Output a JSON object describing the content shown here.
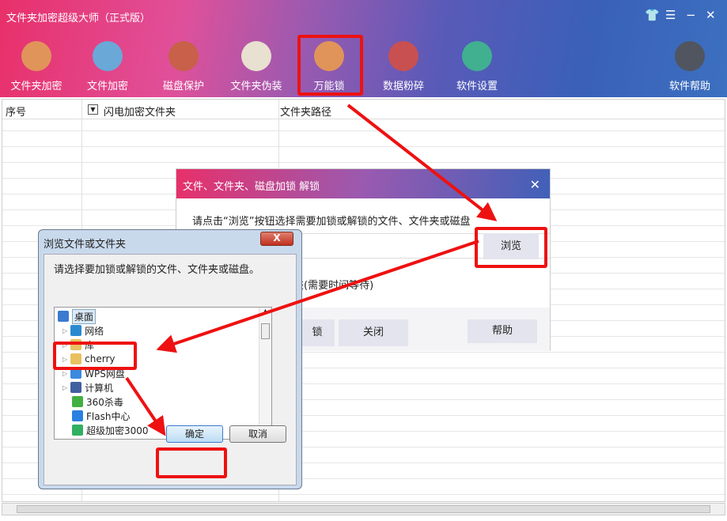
{
  "app": {
    "title": "文件夹加密超级大师（正式版）",
    "controls": [
      "skin",
      "menu",
      "minimize",
      "close"
    ]
  },
  "toolbar": [
    {
      "label": "文件夹加密",
      "icon": "folder-icon",
      "color": "#e0945a"
    },
    {
      "label": "文件加密",
      "icon": "clipboard-icon",
      "color": "#6aa8d8"
    },
    {
      "label": "磁盘保护",
      "icon": "shield-icon",
      "color": "#c8604a"
    },
    {
      "label": "文件夹伪装",
      "icon": "palette-icon",
      "color": "#e8e0d0"
    },
    {
      "label": "万能锁",
      "icon": "lock-icon",
      "color": "#e0945a"
    },
    {
      "label": "数据粉碎",
      "icon": "scissors-icon",
      "color": "#c85050"
    },
    {
      "label": "软件设置",
      "icon": "gear-icon",
      "color": "#40b090"
    },
    {
      "label": "软件帮助",
      "icon": "user-icon",
      "color": "#505560"
    }
  ],
  "table": {
    "columns": [
      "序号",
      "闪电加密文件夹",
      "文件夹路径"
    ]
  },
  "unlock_dialog": {
    "title": "文件、文件夹、磁盘加锁 解锁",
    "instruction": "请点击“浏览”按钮选择需要加锁或解锁的文件、文件夹或磁盘",
    "browse": "浏览",
    "option_fragment": "夹(需要时间等待)",
    "lock_fragment": "锁",
    "close": "关闭",
    "help": "帮助"
  },
  "browse_dialog": {
    "title": "浏览文件或文件夹",
    "prompt": "请选择要加锁或解锁的文件、文件夹或磁盘。",
    "tree": [
      {
        "label": "桌面",
        "icon": "desktop-icon",
        "color": "#3a7ad0",
        "selected": true
      },
      {
        "label": "网络",
        "icon": "network-icon",
        "color": "#2a8ad0"
      },
      {
        "label": "库",
        "icon": "library-icon",
        "color": "#e8c060"
      },
      {
        "label": "cherry",
        "icon": "user-folder-icon",
        "color": "#e8c060"
      },
      {
        "label": "WPS网盘",
        "icon": "cloud-icon",
        "color": "#3a8ae0"
      },
      {
        "label": "计算机",
        "icon": "computer-icon",
        "color": "#4060a0"
      },
      {
        "label": "360杀毒",
        "icon": "360-icon",
        "color": "#40b040"
      },
      {
        "label": "Flash中心",
        "icon": "flash-icon",
        "color": "#2a80e0"
      },
      {
        "label": "超级加密3000",
        "icon": "app-icon",
        "color": "#30b060"
      }
    ],
    "ok": "确定",
    "cancel": "取消"
  },
  "highlight_color": "#ee1111"
}
